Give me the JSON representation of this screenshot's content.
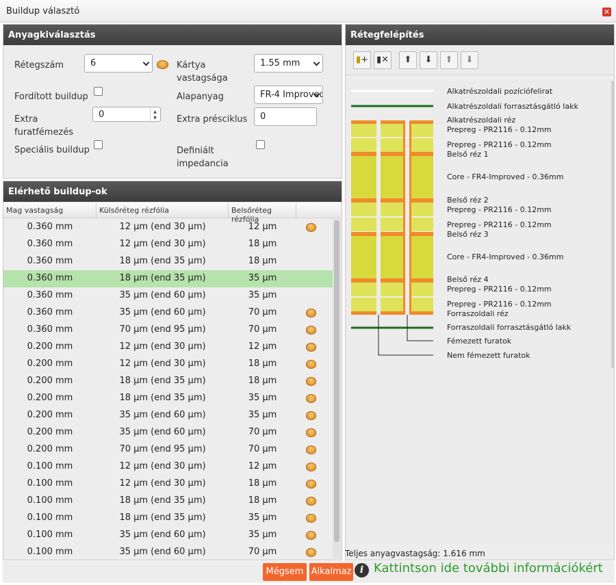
{
  "window": {
    "title": "Buildup választó"
  },
  "material": {
    "header": "Anyagkiválasztás",
    "layer_count_label": "Rétegszám",
    "layer_count_value": "6",
    "reversed_label": "Fordított buildup",
    "extra_plating_label": "Extra furatfémezés",
    "extra_plating_value": "0",
    "special_label": "Speciális buildup",
    "card_thickness_label": "Kártya vastagsága",
    "card_thickness_value": "1.55 mm",
    "base_material_label": "Alapanyag",
    "base_material_value": "FR-4 Improved",
    "extra_press_label": "Extra présciklus",
    "extra_press_value": "0",
    "defined_impedance_label": "Definiált impedancia"
  },
  "buildups": {
    "header": "Elérhető buildup-ok",
    "columns": [
      "Mag vastagság",
      "Külsőréteg rézfólia",
      "Belsőréteg rézfólia"
    ],
    "rows": [
      {
        "core": "0.360 mm",
        "outer": "12 µm (end 30 µm)",
        "inner": "12 µm",
        "coin": true,
        "selected": false
      },
      {
        "core": "0.360 mm",
        "outer": "12 µm (end 30 µm)",
        "inner": "18 µm",
        "coin": false,
        "selected": false
      },
      {
        "core": "0.360 mm",
        "outer": "18 µm (end 35 µm)",
        "inner": "18 µm",
        "coin": false,
        "selected": false
      },
      {
        "core": "0.360 mm",
        "outer": "18 µm (end 35 µm)",
        "inner": "35 µm",
        "coin": false,
        "selected": true
      },
      {
        "core": "0.360 mm",
        "outer": "35 µm (end 60 µm)",
        "inner": "35 µm",
        "coin": false,
        "selected": false
      },
      {
        "core": "0.360 mm",
        "outer": "35 µm (end 60 µm)",
        "inner": "70 µm",
        "coin": true,
        "selected": false
      },
      {
        "core": "0.360 mm",
        "outer": "70 µm (end 95 µm)",
        "inner": "70 µm",
        "coin": true,
        "selected": false
      },
      {
        "core": "0.200 mm",
        "outer": "12 µm (end 30 µm)",
        "inner": "12 µm",
        "coin": true,
        "selected": false
      },
      {
        "core": "0.200 mm",
        "outer": "12 µm (end 30 µm)",
        "inner": "18 µm",
        "coin": true,
        "selected": false
      },
      {
        "core": "0.200 mm",
        "outer": "18 µm (end 35 µm)",
        "inner": "18 µm",
        "coin": true,
        "selected": false
      },
      {
        "core": "0.200 mm",
        "outer": "18 µm (end 35 µm)",
        "inner": "35 µm",
        "coin": true,
        "selected": false
      },
      {
        "core": "0.200 mm",
        "outer": "35 µm (end 60 µm)",
        "inner": "35 µm",
        "coin": true,
        "selected": false
      },
      {
        "core": "0.200 mm",
        "outer": "35 µm (end 60 µm)",
        "inner": "70 µm",
        "coin": true,
        "selected": false
      },
      {
        "core": "0.200 mm",
        "outer": "70 µm (end 95 µm)",
        "inner": "70 µm",
        "coin": true,
        "selected": false
      },
      {
        "core": "0.100 mm",
        "outer": "12 µm (end 30 µm)",
        "inner": "12 µm",
        "coin": true,
        "selected": false
      },
      {
        "core": "0.100 mm",
        "outer": "12 µm (end 30 µm)",
        "inner": "18 µm",
        "coin": true,
        "selected": false
      },
      {
        "core": "0.100 mm",
        "outer": "18 µm (end 35 µm)",
        "inner": "18 µm",
        "coin": true,
        "selected": false
      },
      {
        "core": "0.100 mm",
        "outer": "18 µm (end 35 µm)",
        "inner": "35 µm",
        "coin": true,
        "selected": false
      },
      {
        "core": "0.100 mm",
        "outer": "35 µm (end 60 µm)",
        "inner": "35 µm",
        "coin": true,
        "selected": false
      },
      {
        "core": "0.100 mm",
        "outer": "35 µm (end 60 µm)",
        "inner": "70 µm",
        "coin": true,
        "selected": false
      }
    ]
  },
  "stackup": {
    "header": "Rétegfelépítés",
    "toolbar_icons": [
      "add-layer-icon",
      "remove-layer-icon",
      "move-up-icon",
      "move-down-icon",
      "move-up-alt-icon",
      "move-down-alt-icon"
    ],
    "labels": {
      "silkscreen_top": "Alkatrészoldali pozíciófelirat",
      "soldermask_top": "Alkatrészoldali forrasztásgátló lakk",
      "copper_top": "Alkatrészoldali réz",
      "prepreg_1a": "Prepreg - PR2116 - 0.12mm",
      "prepreg_1b": "Prepreg - PR2116 - 0.12mm",
      "inner_1": "Belső réz 1",
      "core_1": "Core - FR4-Improved - 0.36mm",
      "inner_2": "Belső réz 2",
      "prepreg_2a": "Prepreg - PR2116 - 0.12mm",
      "prepreg_2b": "Prepreg - PR2116 - 0.12mm",
      "inner_3": "Belső réz 3",
      "core_2": "Core - FR4-Improved - 0.36mm",
      "inner_4": "Belső réz 4",
      "prepreg_3a": "Prepreg - PR2116 - 0.12mm",
      "prepreg_3b": "Prepreg - PR2116 - 0.12mm",
      "copper_bottom": "Forraszoldali réz",
      "soldermask_bottom": "Forraszoldali forrasztásgátló lakk",
      "plated_holes": "Fémezett furatok",
      "nonplated_holes": "Nem fémezett furatok"
    },
    "total_thickness": "Teljes anyagvastagság: 1.616 mm",
    "colors": {
      "copper": "#f08a2c",
      "prepreg": "#dfe35a",
      "core": "#d7d93c",
      "soldermask": "#1e6b1e"
    }
  },
  "footer": {
    "cancel_label": "Mégsem",
    "apply_label": "Alkalmaz",
    "info_text": "Kattintson ide további információkért"
  }
}
